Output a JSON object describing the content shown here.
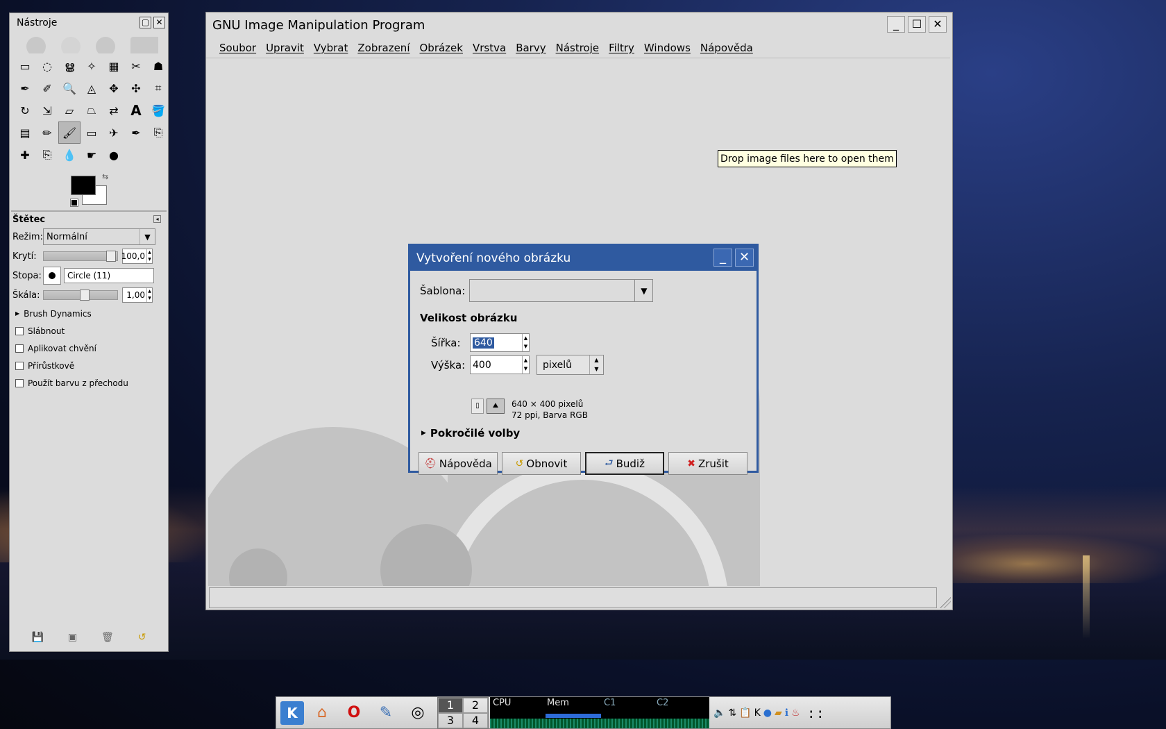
{
  "toolbox": {
    "title": "Nástroje",
    "tools": [
      "rect-select-icon",
      "ellipse-select-icon",
      "lasso-icon",
      "fuzzy-select-icon",
      "color-select-icon",
      "scissors-icon",
      "foreground-select-icon",
      "paths-icon",
      "color-picker-icon",
      "zoom-icon",
      "measure-icon",
      "move-icon",
      "align-icon",
      "crop-icon",
      "rotate-icon",
      "scale-icon",
      "shear-icon",
      "perspective-icon",
      "flip-icon",
      "text-icon",
      "bucket-fill-icon",
      "blend-icon",
      "pencil-icon",
      "paintbrush-icon",
      "eraser-icon",
      "airbrush-icon",
      "ink-icon",
      "clone-icon",
      "heal-icon",
      "perspective-clone-icon",
      "blur-icon",
      "smudge-icon",
      "dodge-icon"
    ],
    "tool_glyphs": [
      "▭",
      "◌",
      "ൠ",
      "✧",
      "▦",
      "✂",
      "☗",
      "✒",
      "✐",
      "🔍",
      "◬",
      "✥",
      "✣",
      "⌗",
      "↻",
      "⇲",
      "▱",
      "⏢",
      "⇄",
      "A",
      "🪣",
      "▤",
      "✏",
      "🖌",
      "▭",
      "✈",
      "✒",
      "⎘",
      "✚",
      "⎘",
      "💧",
      "☛",
      "●"
    ],
    "active_tool": 23,
    "options_title": "Štětec",
    "mode_label": "Režim:",
    "mode_value": "Normální",
    "opacity_label": "Krytí:",
    "opacity_value": "100,0",
    "opacity_fraction": 1.0,
    "brush_label": "Stopa:",
    "brush_value": "Circle (11)",
    "scale_label": "Škála:",
    "scale_value": "1,00",
    "brush_dynamics": "Brush Dynamics",
    "checks": [
      "Slábnout",
      "Aplikovat chvění",
      "Přírůstkově",
      "Použít barvu z přechodu"
    ]
  },
  "main": {
    "title": "GNU Image Manipulation Program",
    "menu": [
      "Soubor",
      "Upravit",
      "Vybrat",
      "Zobrazení",
      "Obrázek",
      "Vrstva",
      "Barvy",
      "Nástroje",
      "Filtry",
      "Windows",
      "Nápověda"
    ],
    "tooltip": "Drop image files here to open them"
  },
  "dialog": {
    "title": "Vytvoření nového obrázku",
    "template_label": "Šablona:",
    "template_value": "",
    "section": "Velikost obrázku",
    "width_label": "Šířka:",
    "width_value": "640",
    "height_label": "Výška:",
    "height_value": "400",
    "unit": "pixelů",
    "info_line1": "640 × 400 pixelů",
    "info_line2": "72 ppi, Barva RGB",
    "advanced": "Pokročilé volby",
    "buttons": {
      "help": "Nápověda",
      "reset": "Obnovit",
      "ok": "Budiž",
      "cancel": "Zrušit"
    }
  },
  "taskbar": {
    "desktops": [
      "1",
      "2",
      "3",
      "4"
    ],
    "current_desktop": "1",
    "sysmon_labels": [
      "CPU",
      "Mem",
      "C1",
      "C2"
    ]
  }
}
